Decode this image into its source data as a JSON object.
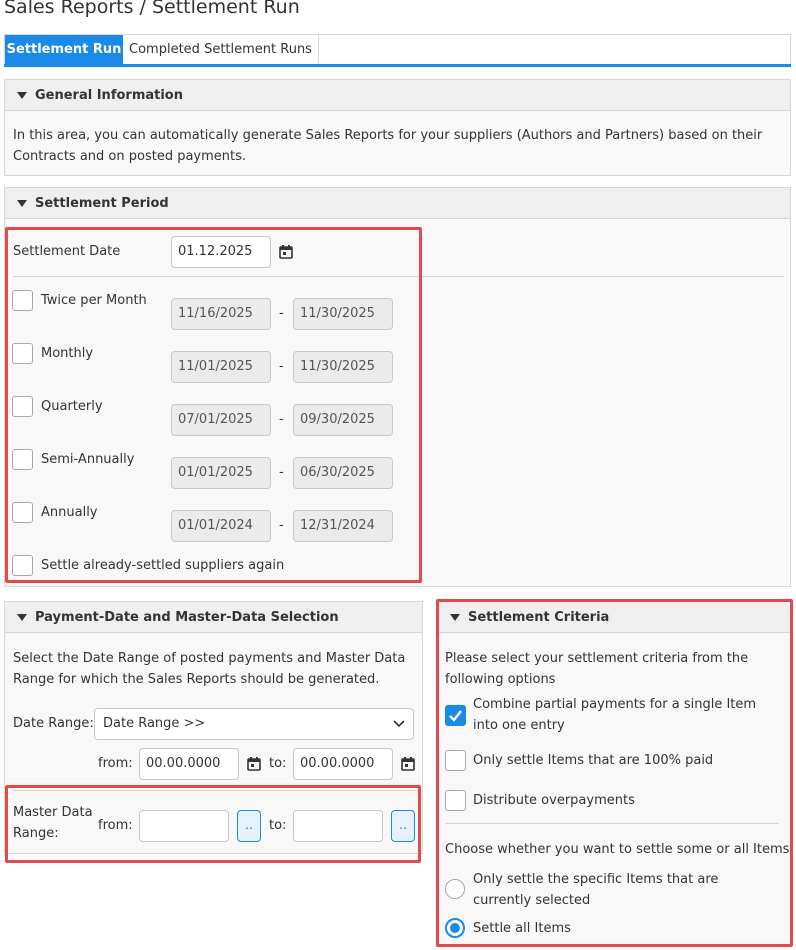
{
  "page": {
    "title": "Sales Reports / Settlement Run"
  },
  "tabs": [
    {
      "label": "Settlement Run",
      "active": true
    },
    {
      "label": "Completed Settlement Runs",
      "active": false
    }
  ],
  "general": {
    "title": "General Information",
    "text": "In this area, you can automatically generate Sales Reports for your suppliers (Authors and Partners) based on their Contracts and on posted payments."
  },
  "period": {
    "title": "Settlement Period",
    "date_label": "Settlement Date",
    "date_value": "01.12.2025",
    "options": [
      {
        "label": "Twice per Month",
        "from": "11/16/2025",
        "to": "11/30/2025",
        "checked": false
      },
      {
        "label": "Monthly",
        "from": "11/01/2025",
        "to": "11/30/2025",
        "checked": false
      },
      {
        "label": "Quarterly",
        "from": "07/01/2025",
        "to": "09/30/2025",
        "checked": false
      },
      {
        "label": "Semi-Annually",
        "from": "01/01/2025",
        "to": "06/30/2025",
        "checked": false
      },
      {
        "label": "Annually",
        "from": "01/01/2024",
        "to": "12/31/2024",
        "checked": false
      }
    ],
    "dash": "-",
    "resettle_label": "Settle already-settled suppliers again"
  },
  "payment": {
    "title": "Payment-Date and Master-Data Selection",
    "text": "Select the Date Range of posted payments and Master Data Range for which the Sales Reports should be generated.",
    "date_range_label": "Date Range:",
    "date_range_value": "Date Range >>",
    "from_label": "from:",
    "to_label": "to:",
    "from_value": "00.00.0000",
    "to_value": "00.00.0000",
    "master_label_1": "Master Data",
    "master_label_2": "Range:",
    "master_from_label": "from:",
    "master_to_label": "to:",
    "master_from_value": "",
    "master_to_value": "",
    "dots": ".."
  },
  "criteria": {
    "title": "Settlement Criteria",
    "intro": "Please select your settlement criteria from the following options",
    "options": [
      {
        "label": "Combine partial payments for a single Item into one entry",
        "checked": true
      },
      {
        "label": "Only settle Items that are 100% paid",
        "checked": false
      },
      {
        "label": "Distribute overpayments",
        "checked": false
      }
    ],
    "scope_intro": "Choose whether you want to settle some or all Items",
    "radios": [
      {
        "label": "Only settle the specific Items that are currently selected",
        "checked": false
      },
      {
        "label": "Settle all Items",
        "checked": true
      }
    ]
  },
  "colors": {
    "accent": "#1a8ae6",
    "highlight": "#e24b4b"
  }
}
